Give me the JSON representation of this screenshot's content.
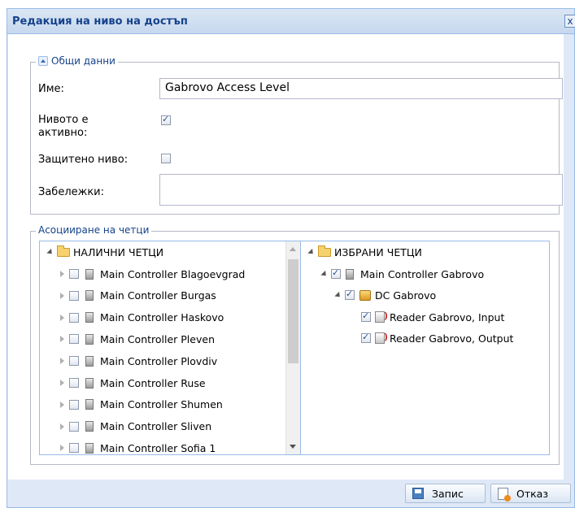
{
  "dialog": {
    "title": "Редакция на ниво на достъп",
    "close_label": "x"
  },
  "general": {
    "legend": "Общи данни",
    "name_label": "Име:",
    "name_value": "Gabrovo Access Level",
    "active_label": "Нивото е активно:",
    "active_checked": true,
    "protected_label": "Защитено ниво:",
    "protected_checked": false,
    "notes_label": "Забележки:",
    "notes_value": ""
  },
  "readers": {
    "legend": "Асоцииране на четци",
    "available": {
      "root_label": "НАЛИЧНИ ЧЕТЦИ",
      "items": [
        {
          "label": "Main Controller Blagoevgrad",
          "checked": false
        },
        {
          "label": "Main Controller Burgas",
          "checked": false
        },
        {
          "label": "Main Controller Haskovo",
          "checked": false
        },
        {
          "label": "Main Controller Pleven",
          "checked": false
        },
        {
          "label": "Main Controller Plovdiv",
          "checked": false
        },
        {
          "label": "Main Controller Ruse",
          "checked": false
        },
        {
          "label": "Main Controller Shumen",
          "checked": false
        },
        {
          "label": "Main Controller Sliven",
          "checked": false
        },
        {
          "label": "Main Controller Sofia 1",
          "checked": false
        }
      ]
    },
    "selected": {
      "root_label": "ИЗБРАНИ ЧЕТЦИ",
      "controller_label": "Main Controller Gabrovo",
      "dc_label": "DC Gabrovo",
      "readers": [
        {
          "label": "Reader Gabrovo, Input",
          "checked": true
        },
        {
          "label": "Reader Gabrovo, Output",
          "checked": true
        }
      ]
    }
  },
  "footer": {
    "save_label": "Запис",
    "cancel_label": "Отказ"
  },
  "colors": {
    "title_text": "#15428b",
    "window_bg": "#dfe8f6",
    "border": "#99bbe8"
  }
}
